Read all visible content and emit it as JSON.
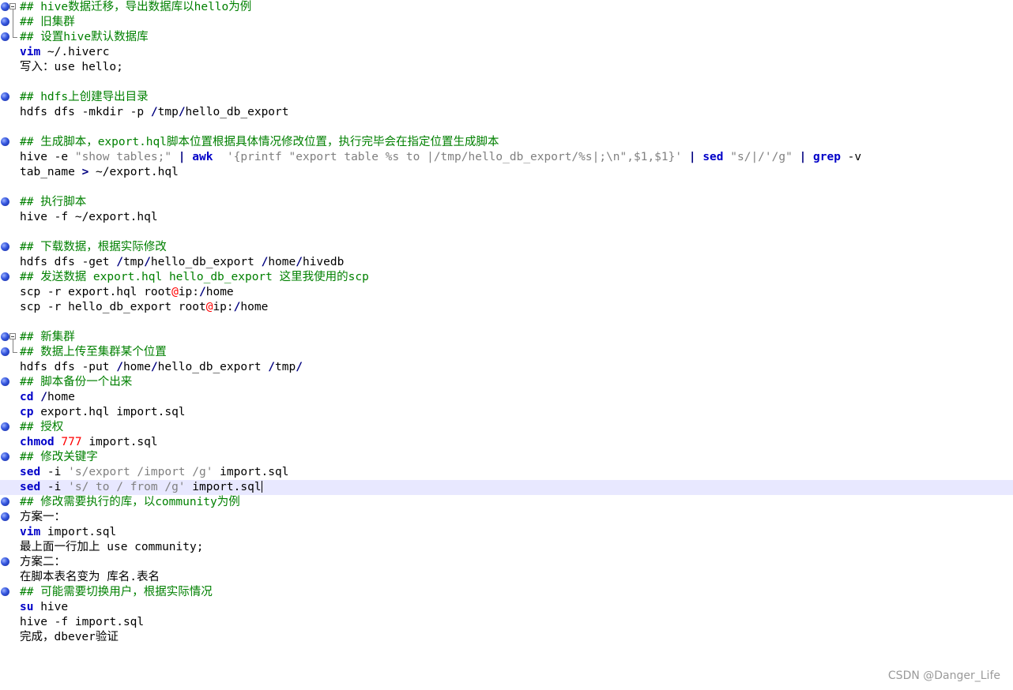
{
  "watermark": "CSDN @Danger_Life",
  "lines": [
    {
      "marker": true,
      "fold": "start",
      "tokens": [
        [
          "cmt",
          "## hive数据迁移，导出数据库以hello为例"
        ]
      ]
    },
    {
      "marker": true,
      "fold": "mid",
      "tokens": [
        [
          "cmt",
          "## 旧集群"
        ]
      ]
    },
    {
      "marker": true,
      "fold": "end",
      "tokens": [
        [
          "cmt",
          "## 设置hive默认数据库"
        ]
      ]
    },
    {
      "tokens": [
        [
          "kw",
          "vim"
        ],
        [
          "",
          " ~/.hiverc"
        ]
      ]
    },
    {
      "tokens": [
        [
          "",
          "写入：use hello;"
        ]
      ]
    },
    {
      "tokens": []
    },
    {
      "marker": true,
      "tokens": [
        [
          "cmt",
          "## hdfs上创建导出目录"
        ]
      ]
    },
    {
      "tokens": [
        [
          "",
          "hdfs dfs -mkdir -p "
        ],
        [
          "op",
          "/"
        ],
        [
          "",
          "tmp"
        ],
        [
          "op",
          "/"
        ],
        [
          "",
          "hello_db_export"
        ]
      ]
    },
    {
      "tokens": []
    },
    {
      "marker": true,
      "tokens": [
        [
          "cmt",
          "## 生成脚本，export.hql脚本位置根据具体情况修改位置，执行完毕会在指定位置生成脚本"
        ]
      ]
    },
    {
      "tokens": [
        [
          "",
          "hive -e "
        ],
        [
          "str",
          "\"show tables;\""
        ],
        [
          "",
          " "
        ],
        [
          "op",
          "|"
        ],
        [
          "",
          " "
        ],
        [
          "kw",
          "awk"
        ],
        [
          "",
          "  "
        ],
        [
          "str",
          "'{printf \"export table %s to |/tmp/hello_db_export/%s|;\\n\",$1,$1}'"
        ],
        [
          "",
          " "
        ],
        [
          "op",
          "|"
        ],
        [
          "",
          " "
        ],
        [
          "kw",
          "sed"
        ],
        [
          "",
          " "
        ],
        [
          "str",
          "\"s/|/'/g\""
        ],
        [
          "",
          " "
        ],
        [
          "op",
          "|"
        ],
        [
          "",
          " "
        ],
        [
          "kw",
          "grep"
        ],
        [
          "",
          " -v"
        ]
      ]
    },
    {
      "tokens": [
        [
          "",
          "tab_name "
        ],
        [
          "op",
          ">"
        ],
        [
          "",
          " ~/export.hql"
        ]
      ]
    },
    {
      "tokens": []
    },
    {
      "marker": true,
      "tokens": [
        [
          "cmt",
          "## 执行脚本"
        ]
      ]
    },
    {
      "tokens": [
        [
          "",
          "hive -f ~/export.hql"
        ]
      ]
    },
    {
      "tokens": []
    },
    {
      "marker": true,
      "tokens": [
        [
          "cmt",
          "## 下载数据，根据实际修改"
        ]
      ]
    },
    {
      "tokens": [
        [
          "",
          "hdfs dfs -get "
        ],
        [
          "op",
          "/"
        ],
        [
          "",
          "tmp"
        ],
        [
          "op",
          "/"
        ],
        [
          "",
          "hello_db_export "
        ],
        [
          "op",
          "/"
        ],
        [
          "",
          "home"
        ],
        [
          "op",
          "/"
        ],
        [
          "",
          "hivedb"
        ]
      ]
    },
    {
      "marker": true,
      "tokens": [
        [
          "cmt",
          "## 发送数据 export.hql hello_db_export 这里我使用的scp"
        ]
      ]
    },
    {
      "tokens": [
        [
          "",
          "scp -r export.hql root"
        ],
        [
          "num",
          "@"
        ],
        [
          "",
          "ip:"
        ],
        [
          "op",
          "/"
        ],
        [
          "",
          "home"
        ]
      ]
    },
    {
      "tokens": [
        [
          "",
          "scp -r hello_db_export root"
        ],
        [
          "num",
          "@"
        ],
        [
          "",
          "ip:"
        ],
        [
          "op",
          "/"
        ],
        [
          "",
          "home"
        ]
      ]
    },
    {
      "tokens": []
    },
    {
      "marker": true,
      "fold": "start",
      "tokens": [
        [
          "cmt",
          "## 新集群"
        ]
      ]
    },
    {
      "marker": true,
      "fold": "end",
      "tokens": [
        [
          "cmt",
          "## 数据上传至集群某个位置"
        ]
      ]
    },
    {
      "tokens": [
        [
          "",
          "hdfs dfs -put "
        ],
        [
          "op",
          "/"
        ],
        [
          "",
          "home"
        ],
        [
          "op",
          "/"
        ],
        [
          "",
          "hello_db_export "
        ],
        [
          "op",
          "/"
        ],
        [
          "",
          "tmp"
        ],
        [
          "op",
          "/"
        ]
      ]
    },
    {
      "marker": true,
      "tokens": [
        [
          "cmt",
          "## 脚本备份一个出来"
        ]
      ]
    },
    {
      "tokens": [
        [
          "kw",
          "cd"
        ],
        [
          "",
          " "
        ],
        [
          "op",
          "/"
        ],
        [
          "",
          "home"
        ]
      ]
    },
    {
      "tokens": [
        [
          "kw",
          "cp"
        ],
        [
          "",
          " export.hql import.sql"
        ]
      ]
    },
    {
      "marker": true,
      "tokens": [
        [
          "cmt",
          "## 授权"
        ]
      ]
    },
    {
      "tokens": [
        [
          "kw",
          "chmod"
        ],
        [
          "",
          " "
        ],
        [
          "num",
          "777"
        ],
        [
          "",
          " import.sql"
        ]
      ]
    },
    {
      "marker": true,
      "tokens": [
        [
          "cmt",
          "## 修改关键字"
        ]
      ]
    },
    {
      "tokens": [
        [
          "kw",
          "sed"
        ],
        [
          "",
          " -i "
        ],
        [
          "str",
          "'s/export /import /g'"
        ],
        [
          "",
          " import.sql"
        ]
      ]
    },
    {
      "current": true,
      "caret": true,
      "tokens": [
        [
          "kw",
          "sed"
        ],
        [
          "",
          " -i "
        ],
        [
          "str",
          "'s/ to / from /g'"
        ],
        [
          "",
          " import.sql"
        ]
      ]
    },
    {
      "marker": true,
      "tokens": [
        [
          "cmt",
          "## 修改需要执行的库，以community为例"
        ]
      ]
    },
    {
      "marker": true,
      "tokens": [
        [
          "",
          "方案一："
        ]
      ]
    },
    {
      "tokens": [
        [
          "kw",
          "vim"
        ],
        [
          "",
          " import.sql"
        ]
      ]
    },
    {
      "tokens": [
        [
          "",
          "最上面一行加上 use community;"
        ]
      ]
    },
    {
      "marker": true,
      "tokens": [
        [
          "",
          "方案二："
        ]
      ]
    },
    {
      "tokens": [
        [
          "",
          "在脚本表名变为 库名.表名"
        ]
      ]
    },
    {
      "marker": true,
      "tokens": [
        [
          "cmt",
          "## 可能需要切换用户，根据实际情况"
        ]
      ]
    },
    {
      "tokens": [
        [
          "kw",
          "su"
        ],
        [
          "",
          " hive"
        ]
      ]
    },
    {
      "tokens": [
        [
          "",
          "hive -f import.sql"
        ]
      ]
    },
    {
      "tokens": [
        [
          "",
          "完成，dbever验证"
        ]
      ]
    }
  ]
}
